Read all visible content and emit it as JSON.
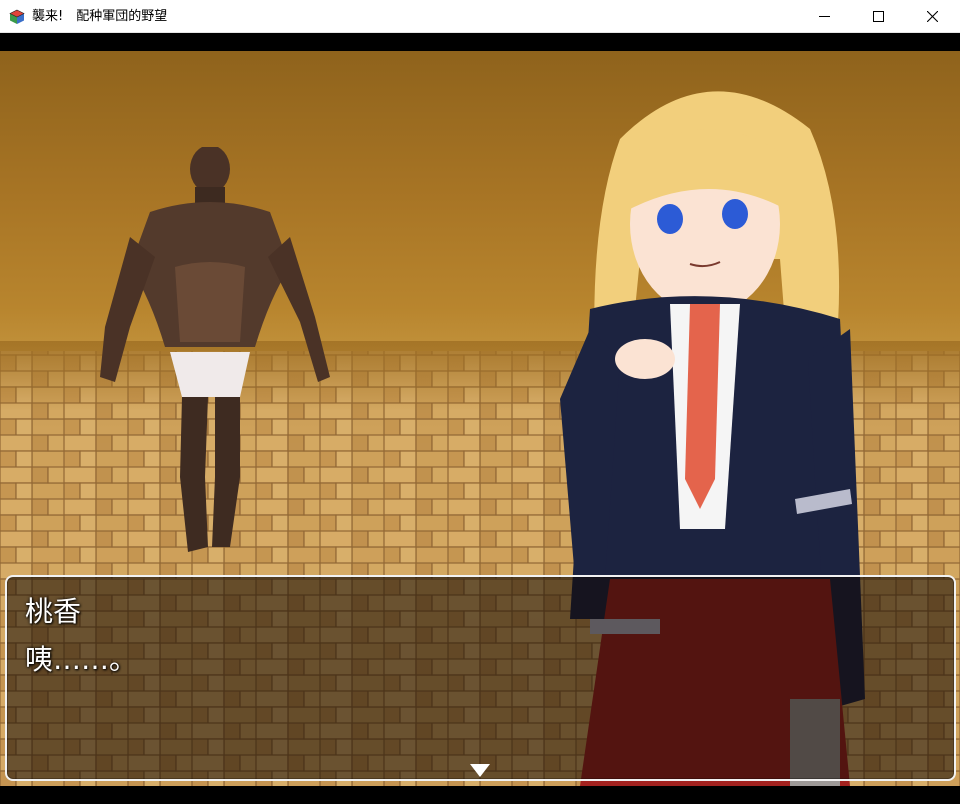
{
  "window": {
    "title": "襲来!　配种軍団的野望",
    "icon": "rpg-maker-cube-icon",
    "buttons": [
      "minimize-icon",
      "maximize-icon",
      "close-icon"
    ]
  },
  "scene": {
    "background": "herringbone-parquet-floor",
    "characters": [
      {
        "role": "enemy",
        "description_icon": "muscular-man-sprite"
      },
      {
        "role": "heroine",
        "description_icon": "blonde-schoolgirl-sprite"
      }
    ]
  },
  "dialogue": {
    "speaker": "桃香",
    "text": "咦……。",
    "advance_icon": "down-triangle-icon"
  },
  "colors": {
    "window_border": "#f2f2f2",
    "text": "#ffffff",
    "uniform_navy": "#1c2340",
    "tie": "#e4644c",
    "skirt": "#a3221f",
    "hair": "#f2cf7c"
  }
}
